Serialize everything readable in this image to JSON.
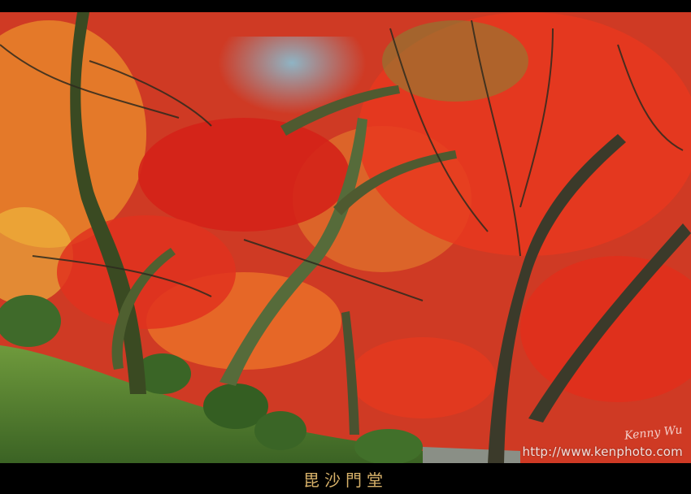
{
  "photo": {
    "signature": "Kenny Wu",
    "watermark": "http://www.kenphoto.com"
  },
  "caption": "毘沙門堂",
  "colors": {
    "frame": "#000000",
    "caption_text": "#d8b26a",
    "maple_red": "#e0321e",
    "maple_orange": "#f07a2a",
    "moss_green": "#4f7a2e"
  }
}
